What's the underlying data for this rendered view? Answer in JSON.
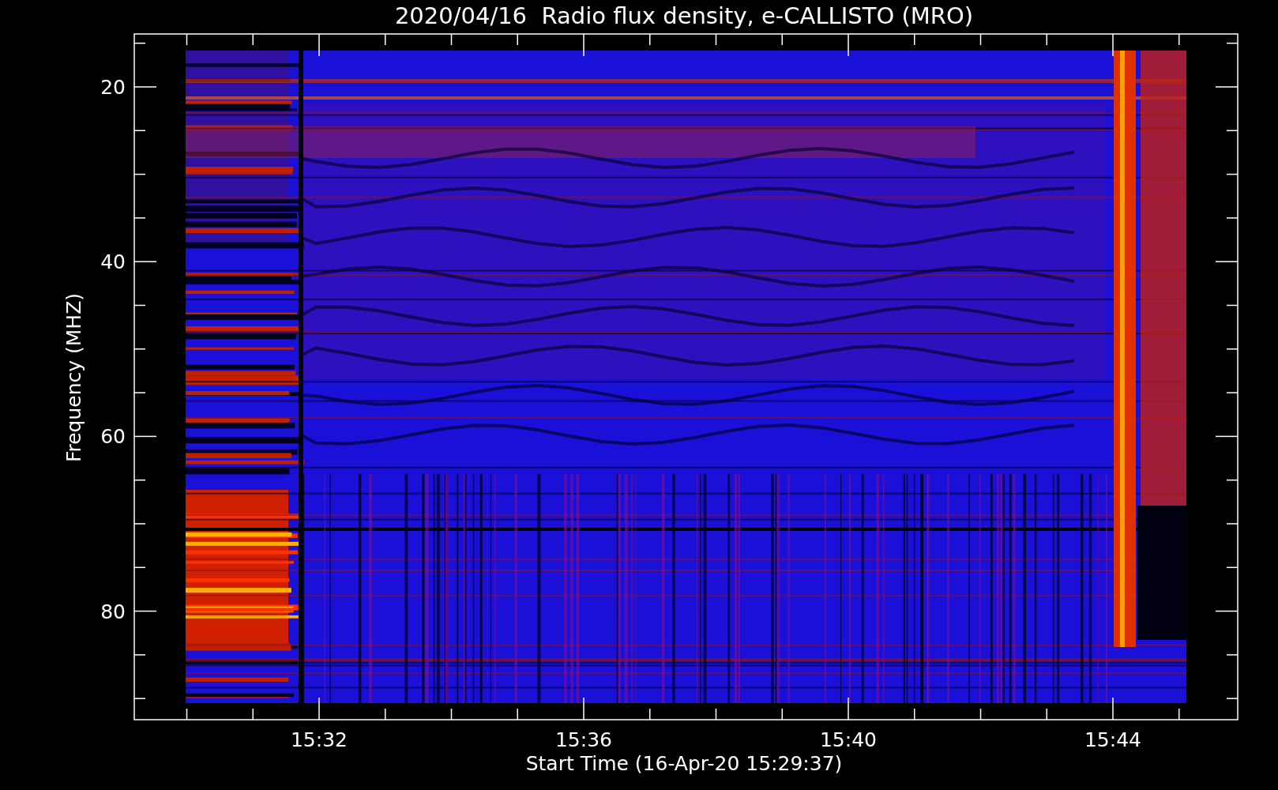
{
  "title": "2020/04/16  Radio flux density, e-CALLISTO (MRO)",
  "plot": {
    "ylabel": "Frequency (MHZ)",
    "xlabel": "Start Time (16-Apr-20 15:29:37)",
    "yticks": [
      "20",
      "40",
      "60",
      "80"
    ],
    "xticks": [
      "15:32",
      "15:36",
      "15:40",
      "15:44"
    ]
  }
}
